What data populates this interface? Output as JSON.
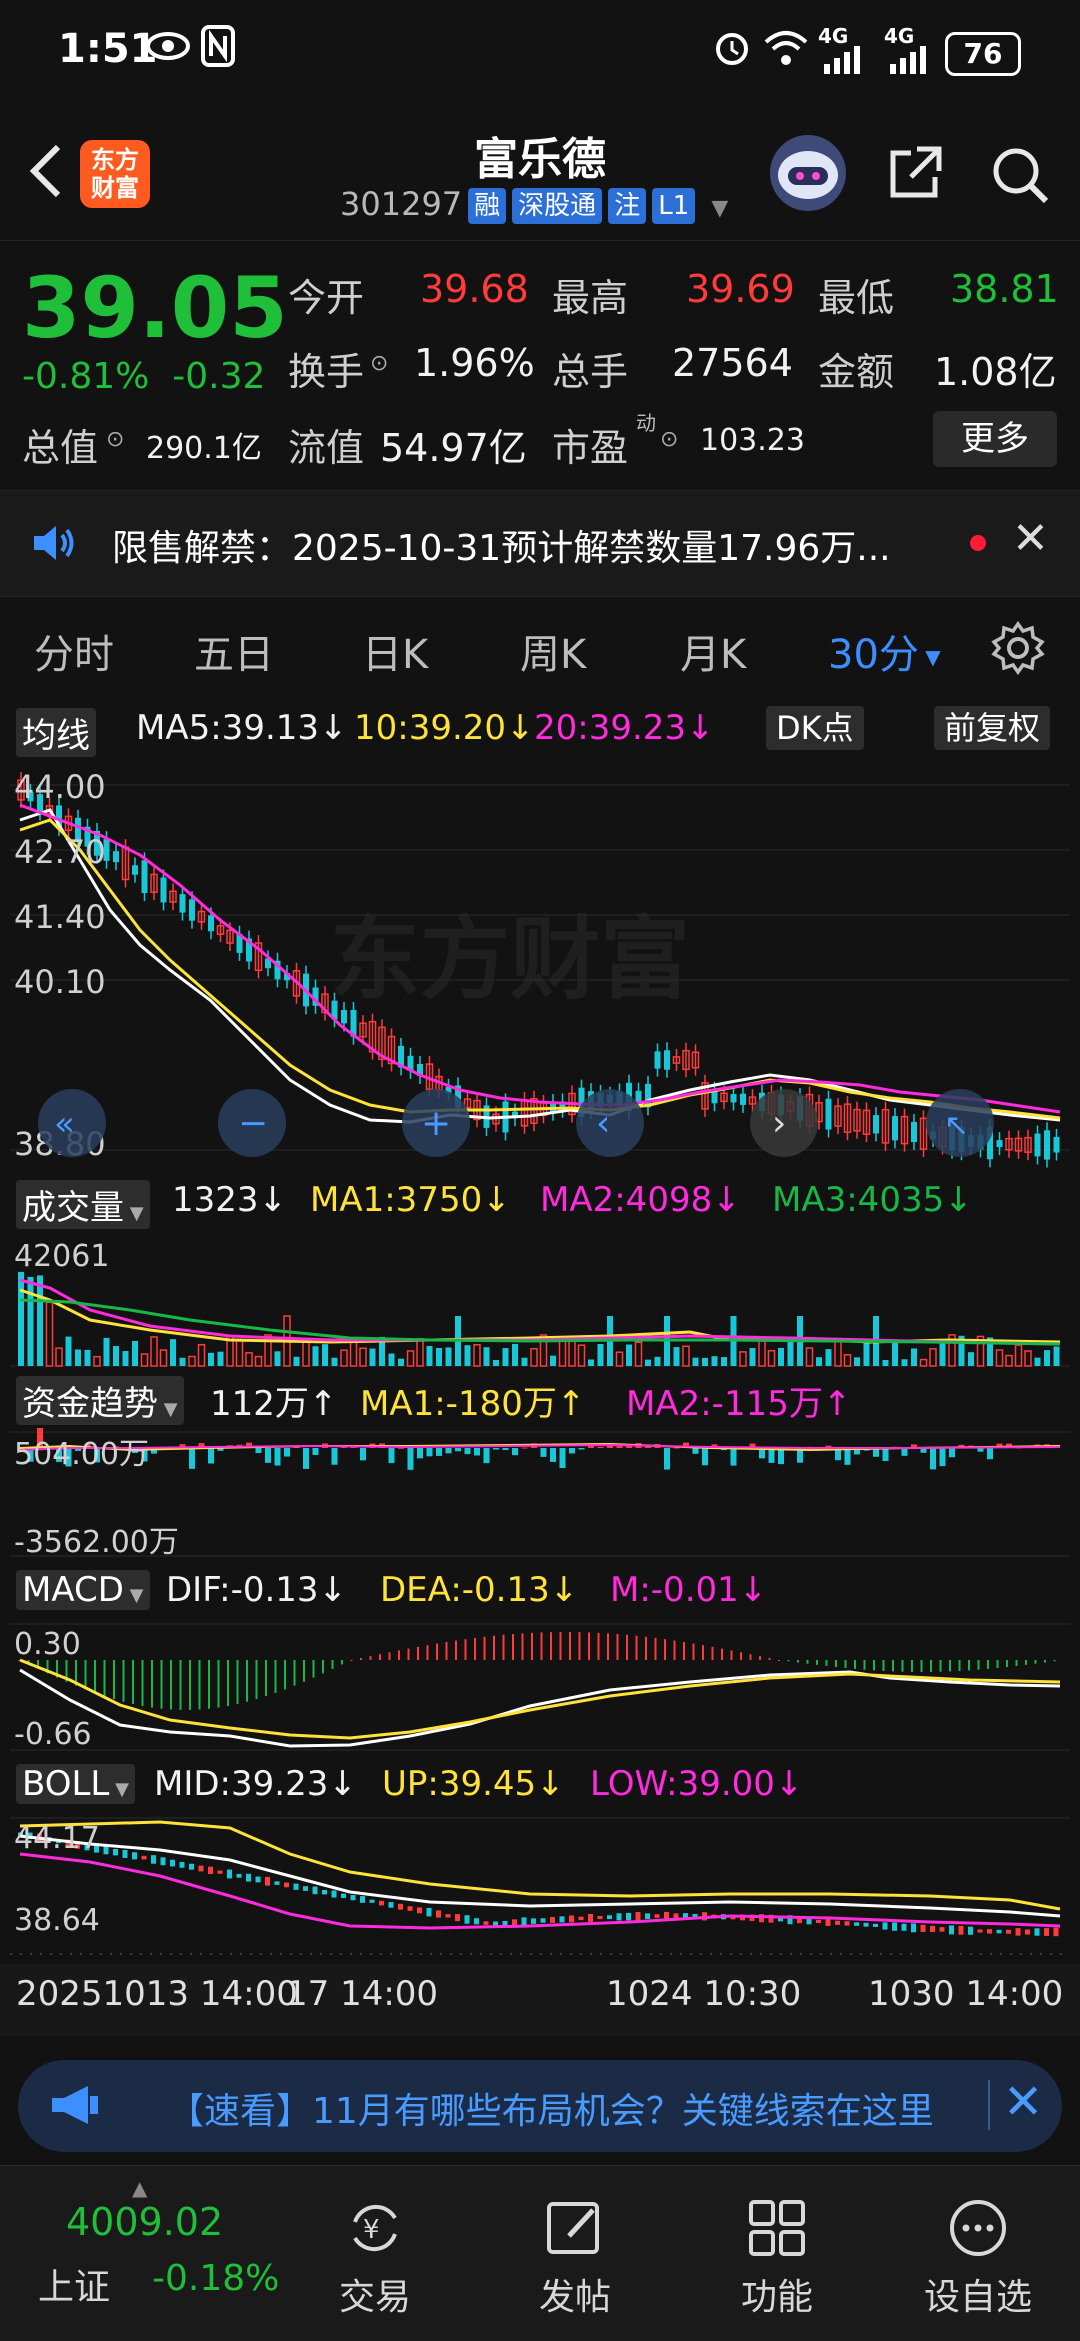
{
  "status_bar": {
    "time": "1:51",
    "network1": "4G",
    "network2": "4G",
    "battery": "76"
  },
  "header": {
    "logo_text_1": "东方",
    "logo_text_2": "财富",
    "stock_name": "富乐德",
    "stock_code": "301297",
    "tags": [
      "融",
      "深股通",
      "注",
      "L1"
    ]
  },
  "quote": {
    "price": "39.05",
    "change_pct": "-0.81%",
    "change_amt": "-0.32",
    "open_label": "今开",
    "open": "39.68",
    "high_label": "最高",
    "high": "39.69",
    "low_label": "最低",
    "low": "38.81",
    "turnover_label": "换手",
    "turnover": "1.96%",
    "volume_label": "总手",
    "volume": "27564",
    "amount_label": "金额",
    "amount": "1.08亿",
    "total_mv_label": "总值",
    "total_mv": "290.1亿",
    "float_mv_label": "流值",
    "float_mv": "54.97亿",
    "pe_label": "市盈",
    "pe_sup": "动",
    "pe": "103.23",
    "more_button": "更多"
  },
  "notice": {
    "text": "限售解禁：2025-10-31预计解禁数量17.96万..."
  },
  "tabs": [
    {
      "label": "分时"
    },
    {
      "label": "五日"
    },
    {
      "label": "日K"
    },
    {
      "label": "周K"
    },
    {
      "label": "月K"
    },
    {
      "label": "30分"
    }
  ],
  "ma_bar": {
    "button": "均线",
    "ma5": "MA5:39.13↓",
    "ma10": "10:39.20↓",
    "ma20": "20:39.23↓",
    "dk_button": "DK点",
    "adjust_button": "前复权"
  },
  "price_axis": [
    "44.00",
    "42.70",
    "41.40",
    "40.10",
    "38.80"
  ],
  "watermark": "东方财富",
  "volume_bar": {
    "button": "成交量",
    "value": "1323↓",
    "ma1": "MA1:3750↓",
    "ma2": "MA2:4098↓",
    "ma3": "MA3:4035↓",
    "axis_top": "42061"
  },
  "fund_bar": {
    "button": "资金趋势",
    "value": "112万↑",
    "ma1": "MA1:-180万↑",
    "ma2": "MA2:-115万↑",
    "axis_top": "504.00万",
    "axis_bottom": "-3562.00万"
  },
  "macd_bar": {
    "button": "MACD",
    "dif": "DIF:-0.13↓",
    "dea": "DEA:-0.13↓",
    "m": "M:-0.01↓",
    "axis_top": "0.30",
    "axis_bottom": "-0.66"
  },
  "boll_bar": {
    "button": "BOLL",
    "mid": "MID:39.23↓",
    "up": "UP:39.45↓",
    "low": "LOW:39.00↓",
    "axis_top": "44.17",
    "axis_bottom": "38.64"
  },
  "time_axis": [
    "20251013 14:00",
    "17 14:00",
    "1024 10:30",
    "1030 14:00"
  ],
  "ticker": {
    "text": "【速看】11月有哪些布局机会？关键线索在这里"
  },
  "nav": {
    "index_value": "4009.02",
    "index_name": "上证",
    "index_change": "-0.18%",
    "items": [
      {
        "label": "交易"
      },
      {
        "label": "发帖"
      },
      {
        "label": "功能"
      },
      {
        "label": "设自选"
      }
    ]
  },
  "colors": {
    "up": "#ff3b3b",
    "down": "#1fbf3a",
    "accent": "#3d8fff",
    "ma10": "#ffe23a",
    "ma20": "#ff2bdc"
  }
}
